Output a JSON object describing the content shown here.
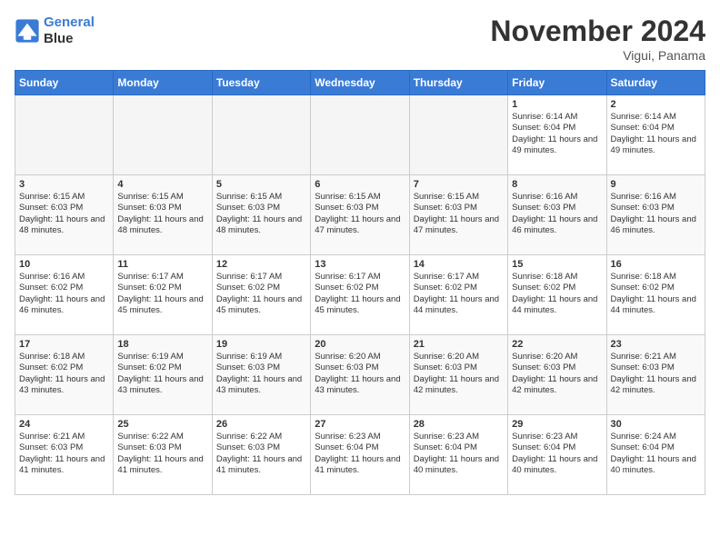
{
  "header": {
    "logo_line1": "General",
    "logo_line2": "Blue",
    "month_title": "November 2024",
    "location": "Vigui, Panama"
  },
  "weekdays": [
    "Sunday",
    "Monday",
    "Tuesday",
    "Wednesday",
    "Thursday",
    "Friday",
    "Saturday"
  ],
  "weeks": [
    [
      {
        "day": "",
        "content": ""
      },
      {
        "day": "",
        "content": ""
      },
      {
        "day": "",
        "content": ""
      },
      {
        "day": "",
        "content": ""
      },
      {
        "day": "",
        "content": ""
      },
      {
        "day": "1",
        "content": "Sunrise: 6:14 AM\nSunset: 6:04 PM\nDaylight: 11 hours and 49 minutes."
      },
      {
        "day": "2",
        "content": "Sunrise: 6:14 AM\nSunset: 6:04 PM\nDaylight: 11 hours and 49 minutes."
      }
    ],
    [
      {
        "day": "3",
        "content": "Sunrise: 6:15 AM\nSunset: 6:03 PM\nDaylight: 11 hours and 48 minutes."
      },
      {
        "day": "4",
        "content": "Sunrise: 6:15 AM\nSunset: 6:03 PM\nDaylight: 11 hours and 48 minutes."
      },
      {
        "day": "5",
        "content": "Sunrise: 6:15 AM\nSunset: 6:03 PM\nDaylight: 11 hours and 48 minutes."
      },
      {
        "day": "6",
        "content": "Sunrise: 6:15 AM\nSunset: 6:03 PM\nDaylight: 11 hours and 47 minutes."
      },
      {
        "day": "7",
        "content": "Sunrise: 6:15 AM\nSunset: 6:03 PM\nDaylight: 11 hours and 47 minutes."
      },
      {
        "day": "8",
        "content": "Sunrise: 6:16 AM\nSunset: 6:03 PM\nDaylight: 11 hours and 46 minutes."
      },
      {
        "day": "9",
        "content": "Sunrise: 6:16 AM\nSunset: 6:03 PM\nDaylight: 11 hours and 46 minutes."
      }
    ],
    [
      {
        "day": "10",
        "content": "Sunrise: 6:16 AM\nSunset: 6:02 PM\nDaylight: 11 hours and 46 minutes."
      },
      {
        "day": "11",
        "content": "Sunrise: 6:17 AM\nSunset: 6:02 PM\nDaylight: 11 hours and 45 minutes."
      },
      {
        "day": "12",
        "content": "Sunrise: 6:17 AM\nSunset: 6:02 PM\nDaylight: 11 hours and 45 minutes."
      },
      {
        "day": "13",
        "content": "Sunrise: 6:17 AM\nSunset: 6:02 PM\nDaylight: 11 hours and 45 minutes."
      },
      {
        "day": "14",
        "content": "Sunrise: 6:17 AM\nSunset: 6:02 PM\nDaylight: 11 hours and 44 minutes."
      },
      {
        "day": "15",
        "content": "Sunrise: 6:18 AM\nSunset: 6:02 PM\nDaylight: 11 hours and 44 minutes."
      },
      {
        "day": "16",
        "content": "Sunrise: 6:18 AM\nSunset: 6:02 PM\nDaylight: 11 hours and 44 minutes."
      }
    ],
    [
      {
        "day": "17",
        "content": "Sunrise: 6:18 AM\nSunset: 6:02 PM\nDaylight: 11 hours and 43 minutes."
      },
      {
        "day": "18",
        "content": "Sunrise: 6:19 AM\nSunset: 6:02 PM\nDaylight: 11 hours and 43 minutes."
      },
      {
        "day": "19",
        "content": "Sunrise: 6:19 AM\nSunset: 6:03 PM\nDaylight: 11 hours and 43 minutes."
      },
      {
        "day": "20",
        "content": "Sunrise: 6:20 AM\nSunset: 6:03 PM\nDaylight: 11 hours and 43 minutes."
      },
      {
        "day": "21",
        "content": "Sunrise: 6:20 AM\nSunset: 6:03 PM\nDaylight: 11 hours and 42 minutes."
      },
      {
        "day": "22",
        "content": "Sunrise: 6:20 AM\nSunset: 6:03 PM\nDaylight: 11 hours and 42 minutes."
      },
      {
        "day": "23",
        "content": "Sunrise: 6:21 AM\nSunset: 6:03 PM\nDaylight: 11 hours and 42 minutes."
      }
    ],
    [
      {
        "day": "24",
        "content": "Sunrise: 6:21 AM\nSunset: 6:03 PM\nDaylight: 11 hours and 41 minutes."
      },
      {
        "day": "25",
        "content": "Sunrise: 6:22 AM\nSunset: 6:03 PM\nDaylight: 11 hours and 41 minutes."
      },
      {
        "day": "26",
        "content": "Sunrise: 6:22 AM\nSunset: 6:03 PM\nDaylight: 11 hours and 41 minutes."
      },
      {
        "day": "27",
        "content": "Sunrise: 6:23 AM\nSunset: 6:04 PM\nDaylight: 11 hours and 41 minutes."
      },
      {
        "day": "28",
        "content": "Sunrise: 6:23 AM\nSunset: 6:04 PM\nDaylight: 11 hours and 40 minutes."
      },
      {
        "day": "29",
        "content": "Sunrise: 6:23 AM\nSunset: 6:04 PM\nDaylight: 11 hours and 40 minutes."
      },
      {
        "day": "30",
        "content": "Sunrise: 6:24 AM\nSunset: 6:04 PM\nDaylight: 11 hours and 40 minutes."
      }
    ]
  ]
}
